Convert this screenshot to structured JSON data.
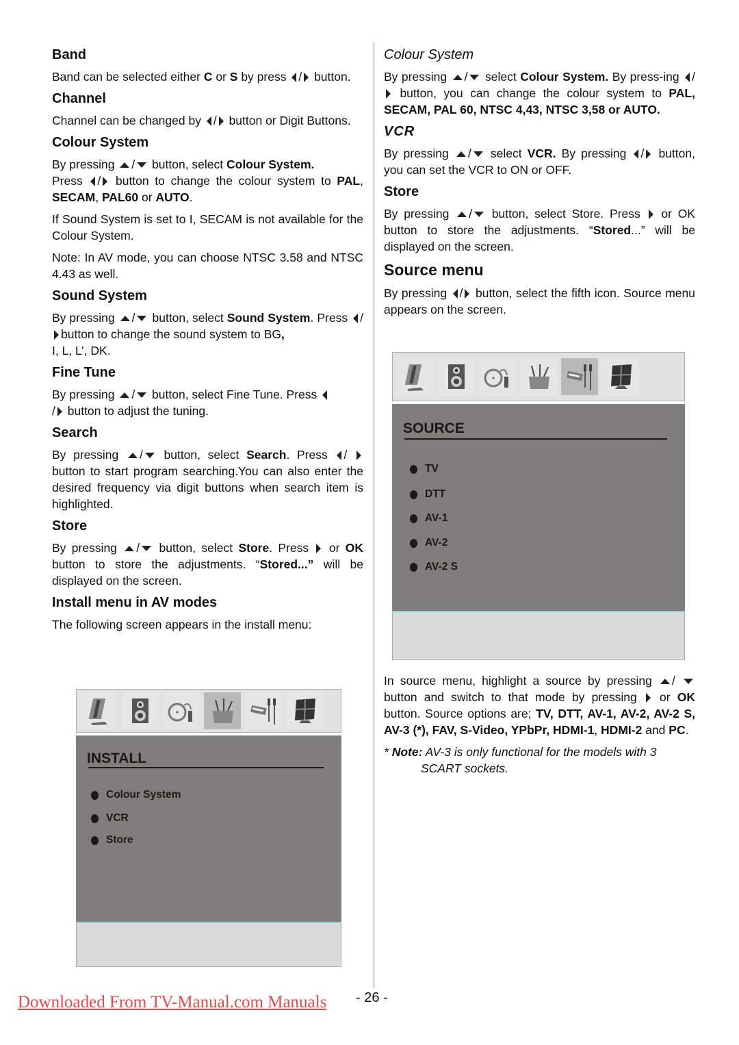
{
  "left": {
    "band": {
      "title": "Band",
      "text_1": "Band can be selected either ",
      "c": "C",
      "or": " or ",
      "s": "S",
      "text_2": " by press",
      "text_3": "button."
    },
    "channel": {
      "title": "Channel",
      "text_1": "Channel can be changed by ",
      "text_2": " button or Digit Buttons."
    },
    "colour_system": {
      "title": "Colour System",
      "p1_a": "By pressing",
      "p1_b": " button, select ",
      "p1_bold": "Colour System.",
      "p2_a": "Press ",
      "p2_b": " button to change the colour system to ",
      "pal": "PAL",
      "secam": "SECAM",
      "pal60": "PAL60",
      "or": " or ",
      "auto": "AUTO",
      "p3": "If Sound  System is set to I, SECAM is not available for the Colour System.",
      "p4": "Note: In AV mode, you can choose NTSC 3.58 and NTSC 4.43 as well."
    },
    "sound_system": {
      "title": "Sound System",
      "p1_a": "By pressing",
      "p1_b": " button, select ",
      "p1_bold": "Sound System",
      "p2_a": "Press ",
      "p2_b": "button to change the sound system to BG",
      "p2_c": " I, L, L’, DK."
    },
    "fine_tune": {
      "title": "Fine Tune",
      "p1_a": "By pressing",
      "p1_b": " button, select Fine Tune. Press",
      "p1_c": " button to adjust the tuning."
    },
    "search": {
      "title": "Search",
      "p1_a": "By pressing",
      "p1_b": " button, select ",
      "p1_bold": "Search",
      "p1_c": ".  Press",
      "p1_d": " button to start program searching.You can also enter the desired frequency via digit buttons when search item is highlighted."
    },
    "store": {
      "title": "Store",
      "p1_a": "By pressing",
      "p1_b": " button, select ",
      "p1_bold": "Store",
      "p1_c": ". Press",
      "p1_d": " or ",
      "ok": "OK",
      "p1_e": " button to store the adjustments. “",
      "stored": "Stored...”",
      "p1_f": " will be displayed on the screen."
    },
    "install_av": {
      "title": "Install menu in AV modes",
      "p1": "The following screen appears in the install menu:"
    }
  },
  "install_menu": {
    "icons": [
      "picture-icon",
      "sound-icon",
      "feature-icon",
      "install-icon",
      "source-icon",
      "pc-icon"
    ],
    "selected_index": 3,
    "title": "INSTALL",
    "items": [
      "Colour System",
      "VCR",
      "Store"
    ]
  },
  "right": {
    "colour_system": {
      "title": "Colour System",
      "p1_a": "By pressing",
      "p1_b": " select ",
      "p1_bold": "Colour System.",
      "p1_c": " By press-ing",
      "p1_d": " button, you can change the colour system to ",
      "options": "PAL, SECAM, PAL 60, NTSC 4,43, NTSC 3,58 or AUTO."
    },
    "vcr": {
      "title": "VCR",
      "p1_a": "By pressing",
      "p1_b": " select ",
      "p1_bold": "VCR.",
      "p1_c": " By pressing",
      "p1_d": " button, you can set the VCR to ON or OFF."
    },
    "store": {
      "title": "Store",
      "p1_a": "By pressing",
      "p1_b": " button, select Store.  Press",
      "p1_c": " or OK button to store the adjustments. “",
      "stored": "Stored",
      "p1_d": "...” will be displayed on the screen."
    },
    "source_menu": {
      "title": "Source menu",
      "p1_a": "By pressing",
      "p1_b": " button, select the fifth icon. Source menu appears on the screen.",
      "p2_a": "In source menu, highlight a source by pressing",
      "p2_b": " button and switch to that mode by pressing",
      "p2_c": " or ",
      "ok": "OK",
      "p2_d": " button. Source options are; ",
      "options_bold": "TV, DTT, AV-1, AV-2, AV-2 S, AV-3 (*), FAV, S-Video, YPbPr, HDMI-1",
      "comma": ", ",
      "hdmi2": "HDMI-2",
      "and": " and ",
      "pc": "PC",
      "period": ".",
      "note_star": "* ",
      "note_label": "Note:",
      "note_text": " AV-3 is only functional for the models with 3",
      "note_text2": "SCART sockets."
    }
  },
  "source_menu_screen": {
    "icons": [
      "picture-icon",
      "sound-icon",
      "feature-icon",
      "install-icon",
      "source-icon",
      "pc-icon"
    ],
    "selected_index": 4,
    "title": "SOURCE",
    "items": [
      "TV",
      "DTT",
      "AV-1",
      "AV-2",
      "AV-2 S"
    ]
  },
  "footer": {
    "download_link": "Downloaded From TV-Manual.com Manuals",
    "page_number": "- 26 -"
  }
}
